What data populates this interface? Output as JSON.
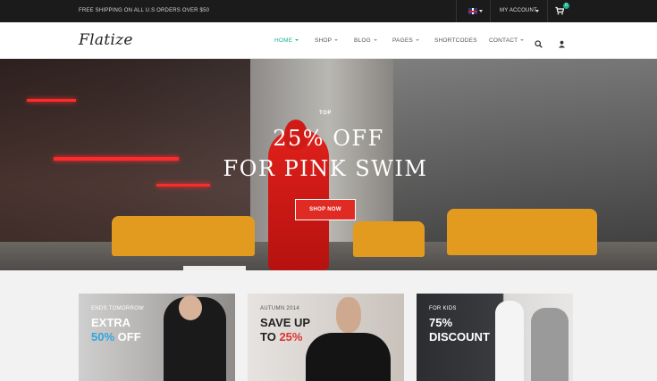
{
  "topbar": {
    "shipping_text": "FREE SHIPPING ON ALL U.S ORDERS OVER $50",
    "account_label": "MY ACCOUNT",
    "cart_count": "0",
    "language_flag": "uk-flag-icon",
    "cart_icon": "cart-icon"
  },
  "header": {
    "logo": "Flatize",
    "nav": [
      {
        "label": "HOME",
        "active": true
      },
      {
        "label": "SHOP"
      },
      {
        "label": "BLOG"
      },
      {
        "label": "PAGES"
      },
      {
        "label": "SHORTCODES"
      },
      {
        "label": "CONTACT"
      }
    ],
    "search_icon": "search-icon",
    "user_icon": "user-icon",
    "accent_color": "#18b28f"
  },
  "hero": {
    "tag": "TOP",
    "line1": "25% OFF",
    "line2": "FOR PINK SWIM",
    "button_label": "SHOP NOW",
    "button_color": "#e02b24"
  },
  "promos": [
    {
      "small": "ENDS TOMORROW",
      "big_line1": "EXTRA",
      "big_line2_highlight": "50%",
      "big_line2_rest": " OFF",
      "highlight_color": "#2fa6e0"
    },
    {
      "small": "AUTUMN 2014",
      "big_line1": "SAVE UP",
      "big_line2_prefix": "TO ",
      "big_line2_highlight": "25%",
      "highlight_color": "#e0332d"
    },
    {
      "small": "FOR KIDS",
      "big_line1_highlight": "75%",
      "big_line2": "DISCOUNT",
      "highlight_color": "#18c29c"
    }
  ]
}
